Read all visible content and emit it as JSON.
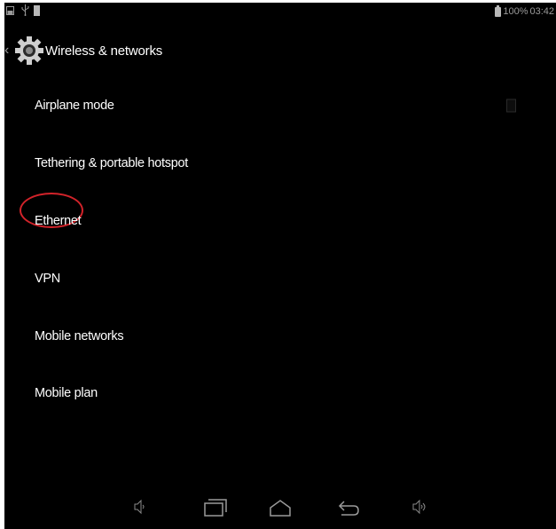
{
  "status_bar": {
    "left_icons": [
      "screenshot-notification-icon",
      "usb-icon",
      "download-icon"
    ],
    "battery_icon": "battery-charging-icon",
    "battery_text": "100%",
    "time": "03:42"
  },
  "action_bar": {
    "back_icon": "chevron-left-icon",
    "app_icon": "settings-gear-icon",
    "title": "Wireless & networks"
  },
  "list": {
    "items": [
      {
        "label": "Airplane mode",
        "has_checkbox": true,
        "checked": false
      },
      {
        "label": "Tethering & portable hotspot"
      },
      {
        "label": "Ethernet",
        "highlighted": true
      },
      {
        "label": "VPN"
      },
      {
        "label": "Mobile networks"
      },
      {
        "label": "Mobile plan"
      }
    ]
  },
  "nav_bar": {
    "icons": [
      "volume-down-icon",
      "recent-apps-icon",
      "home-icon",
      "back-icon",
      "volume-up-icon"
    ]
  },
  "colors": {
    "background": "#000000",
    "text": "#ffffff",
    "secondary": "#9a9a9a",
    "annotation": "#d2232a"
  }
}
